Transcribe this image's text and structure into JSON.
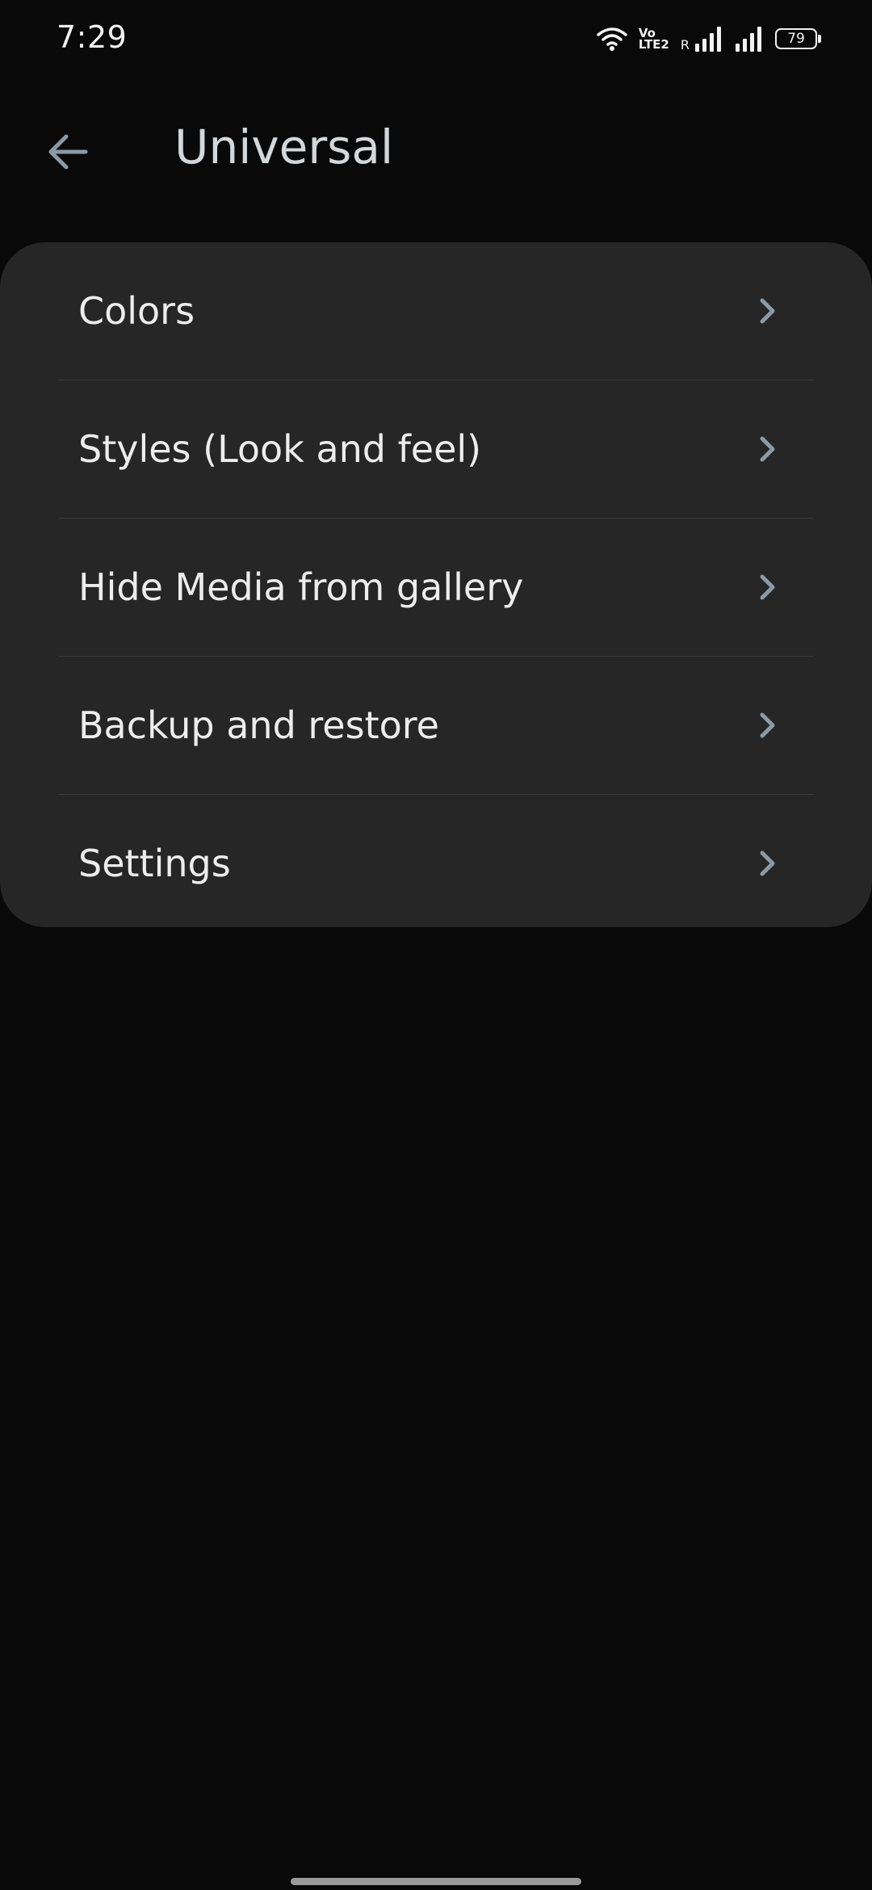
{
  "status_bar": {
    "time": "7:29",
    "volte_top": "Vo",
    "volte_bottom": "LTE2",
    "roaming": "R",
    "battery": "79",
    "icons": [
      "wifi-icon",
      "volte-icon",
      "signal-icon",
      "signal-icon",
      "battery-icon"
    ]
  },
  "app_bar": {
    "back_icon": "arrow-left-icon",
    "title": "Universal"
  },
  "menu": {
    "items": [
      {
        "label": "Colors",
        "icon": "chevron-right-icon"
      },
      {
        "label": "Styles (Look and feel)",
        "icon": "chevron-right-icon"
      },
      {
        "label": "Hide Media from gallery",
        "icon": "chevron-right-icon"
      },
      {
        "label": "Backup and restore",
        "icon": "chevron-right-icon"
      },
      {
        "label": "Settings",
        "icon": "chevron-right-icon"
      }
    ]
  },
  "colors": {
    "background": "#090909",
    "card": "#262627",
    "title": "#d4d7da",
    "accent_icon": "#8a9aa6"
  }
}
